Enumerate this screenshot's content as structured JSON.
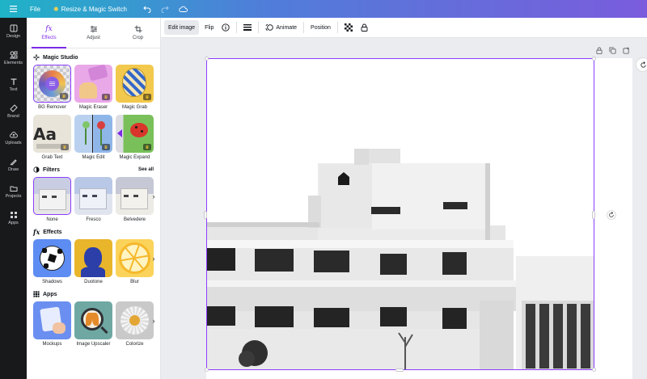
{
  "topbar": {
    "file_label": "File",
    "resize_label": "Resize & Magic Switch"
  },
  "rail": [
    {
      "label": "Design",
      "icon": "design-icon"
    },
    {
      "label": "Elements",
      "icon": "elements-icon"
    },
    {
      "label": "Text",
      "icon": "text-icon"
    },
    {
      "label": "Brand",
      "icon": "brand-icon"
    },
    {
      "label": "Uploads",
      "icon": "uploads-icon"
    },
    {
      "label": "Draw",
      "icon": "draw-icon"
    },
    {
      "label": "Projects",
      "icon": "projects-icon"
    },
    {
      "label": "Apps",
      "icon": "apps-icon"
    }
  ],
  "panel": {
    "tabs": [
      {
        "label": "Effects",
        "icon": "fx-icon"
      },
      {
        "label": "Adjust",
        "icon": "sliders-icon"
      },
      {
        "label": "Crop",
        "icon": "crop-icon"
      }
    ],
    "magic_studio": {
      "title": "Magic Studio",
      "items": [
        "BG Remover",
        "Magic Eraser",
        "Magic Grab",
        "Grab Text",
        "Magic Edit",
        "Magic Expand"
      ]
    },
    "filters": {
      "title": "Filters",
      "see_all": "See all",
      "items": [
        "None",
        "Fresco",
        "Belvedere"
      ]
    },
    "effects": {
      "title": "Effects",
      "items": [
        "Shadows",
        "Duotone",
        "Blur"
      ]
    },
    "apps": {
      "title": "Apps",
      "items": [
        "Mockups",
        "Image Upscaler",
        "Colorize"
      ]
    }
  },
  "toolbar": {
    "edit_image": "Edit image",
    "flip": "Flip",
    "animate": "Animate",
    "position": "Position"
  },
  "colors": {
    "accent": "#7d2ae8",
    "selection": "#8b3dff",
    "rail_bg": "#18191b"
  }
}
